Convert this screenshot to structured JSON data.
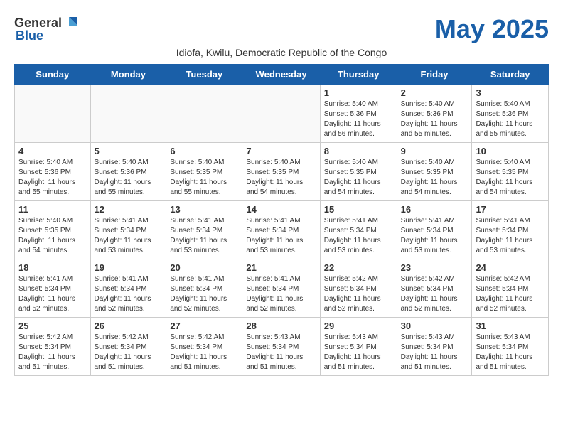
{
  "logo": {
    "general": "General",
    "blue": "Blue"
  },
  "title": "May 2025",
  "subtitle": "Idiofa, Kwilu, Democratic Republic of the Congo",
  "days": [
    "Sunday",
    "Monday",
    "Tuesday",
    "Wednesday",
    "Thursday",
    "Friday",
    "Saturday"
  ],
  "weeks": [
    [
      {
        "day": "",
        "info": ""
      },
      {
        "day": "",
        "info": ""
      },
      {
        "day": "",
        "info": ""
      },
      {
        "day": "",
        "info": ""
      },
      {
        "day": "1",
        "info": "Sunrise: 5:40 AM\nSunset: 5:36 PM\nDaylight: 11 hours and 56 minutes."
      },
      {
        "day": "2",
        "info": "Sunrise: 5:40 AM\nSunset: 5:36 PM\nDaylight: 11 hours and 55 minutes."
      },
      {
        "day": "3",
        "info": "Sunrise: 5:40 AM\nSunset: 5:36 PM\nDaylight: 11 hours and 55 minutes."
      }
    ],
    [
      {
        "day": "4",
        "info": "Sunrise: 5:40 AM\nSunset: 5:36 PM\nDaylight: 11 hours and 55 minutes."
      },
      {
        "day": "5",
        "info": "Sunrise: 5:40 AM\nSunset: 5:36 PM\nDaylight: 11 hours and 55 minutes."
      },
      {
        "day": "6",
        "info": "Sunrise: 5:40 AM\nSunset: 5:35 PM\nDaylight: 11 hours and 55 minutes."
      },
      {
        "day": "7",
        "info": "Sunrise: 5:40 AM\nSunset: 5:35 PM\nDaylight: 11 hours and 54 minutes."
      },
      {
        "day": "8",
        "info": "Sunrise: 5:40 AM\nSunset: 5:35 PM\nDaylight: 11 hours and 54 minutes."
      },
      {
        "day": "9",
        "info": "Sunrise: 5:40 AM\nSunset: 5:35 PM\nDaylight: 11 hours and 54 minutes."
      },
      {
        "day": "10",
        "info": "Sunrise: 5:40 AM\nSunset: 5:35 PM\nDaylight: 11 hours and 54 minutes."
      }
    ],
    [
      {
        "day": "11",
        "info": "Sunrise: 5:40 AM\nSunset: 5:35 PM\nDaylight: 11 hours and 54 minutes."
      },
      {
        "day": "12",
        "info": "Sunrise: 5:41 AM\nSunset: 5:34 PM\nDaylight: 11 hours and 53 minutes."
      },
      {
        "day": "13",
        "info": "Sunrise: 5:41 AM\nSunset: 5:34 PM\nDaylight: 11 hours and 53 minutes."
      },
      {
        "day": "14",
        "info": "Sunrise: 5:41 AM\nSunset: 5:34 PM\nDaylight: 11 hours and 53 minutes."
      },
      {
        "day": "15",
        "info": "Sunrise: 5:41 AM\nSunset: 5:34 PM\nDaylight: 11 hours and 53 minutes."
      },
      {
        "day": "16",
        "info": "Sunrise: 5:41 AM\nSunset: 5:34 PM\nDaylight: 11 hours and 53 minutes."
      },
      {
        "day": "17",
        "info": "Sunrise: 5:41 AM\nSunset: 5:34 PM\nDaylight: 11 hours and 53 minutes."
      }
    ],
    [
      {
        "day": "18",
        "info": "Sunrise: 5:41 AM\nSunset: 5:34 PM\nDaylight: 11 hours and 52 minutes."
      },
      {
        "day": "19",
        "info": "Sunrise: 5:41 AM\nSunset: 5:34 PM\nDaylight: 11 hours and 52 minutes."
      },
      {
        "day": "20",
        "info": "Sunrise: 5:41 AM\nSunset: 5:34 PM\nDaylight: 11 hours and 52 minutes."
      },
      {
        "day": "21",
        "info": "Sunrise: 5:41 AM\nSunset: 5:34 PM\nDaylight: 11 hours and 52 minutes."
      },
      {
        "day": "22",
        "info": "Sunrise: 5:42 AM\nSunset: 5:34 PM\nDaylight: 11 hours and 52 minutes."
      },
      {
        "day": "23",
        "info": "Sunrise: 5:42 AM\nSunset: 5:34 PM\nDaylight: 11 hours and 52 minutes."
      },
      {
        "day": "24",
        "info": "Sunrise: 5:42 AM\nSunset: 5:34 PM\nDaylight: 11 hours and 52 minutes."
      }
    ],
    [
      {
        "day": "25",
        "info": "Sunrise: 5:42 AM\nSunset: 5:34 PM\nDaylight: 11 hours and 51 minutes."
      },
      {
        "day": "26",
        "info": "Sunrise: 5:42 AM\nSunset: 5:34 PM\nDaylight: 11 hours and 51 minutes."
      },
      {
        "day": "27",
        "info": "Sunrise: 5:42 AM\nSunset: 5:34 PM\nDaylight: 11 hours and 51 minutes."
      },
      {
        "day": "28",
        "info": "Sunrise: 5:43 AM\nSunset: 5:34 PM\nDaylight: 11 hours and 51 minutes."
      },
      {
        "day": "29",
        "info": "Sunrise: 5:43 AM\nSunset: 5:34 PM\nDaylight: 11 hours and 51 minutes."
      },
      {
        "day": "30",
        "info": "Sunrise: 5:43 AM\nSunset: 5:34 PM\nDaylight: 11 hours and 51 minutes."
      },
      {
        "day": "31",
        "info": "Sunrise: 5:43 AM\nSunset: 5:34 PM\nDaylight: 11 hours and 51 minutes."
      }
    ]
  ]
}
